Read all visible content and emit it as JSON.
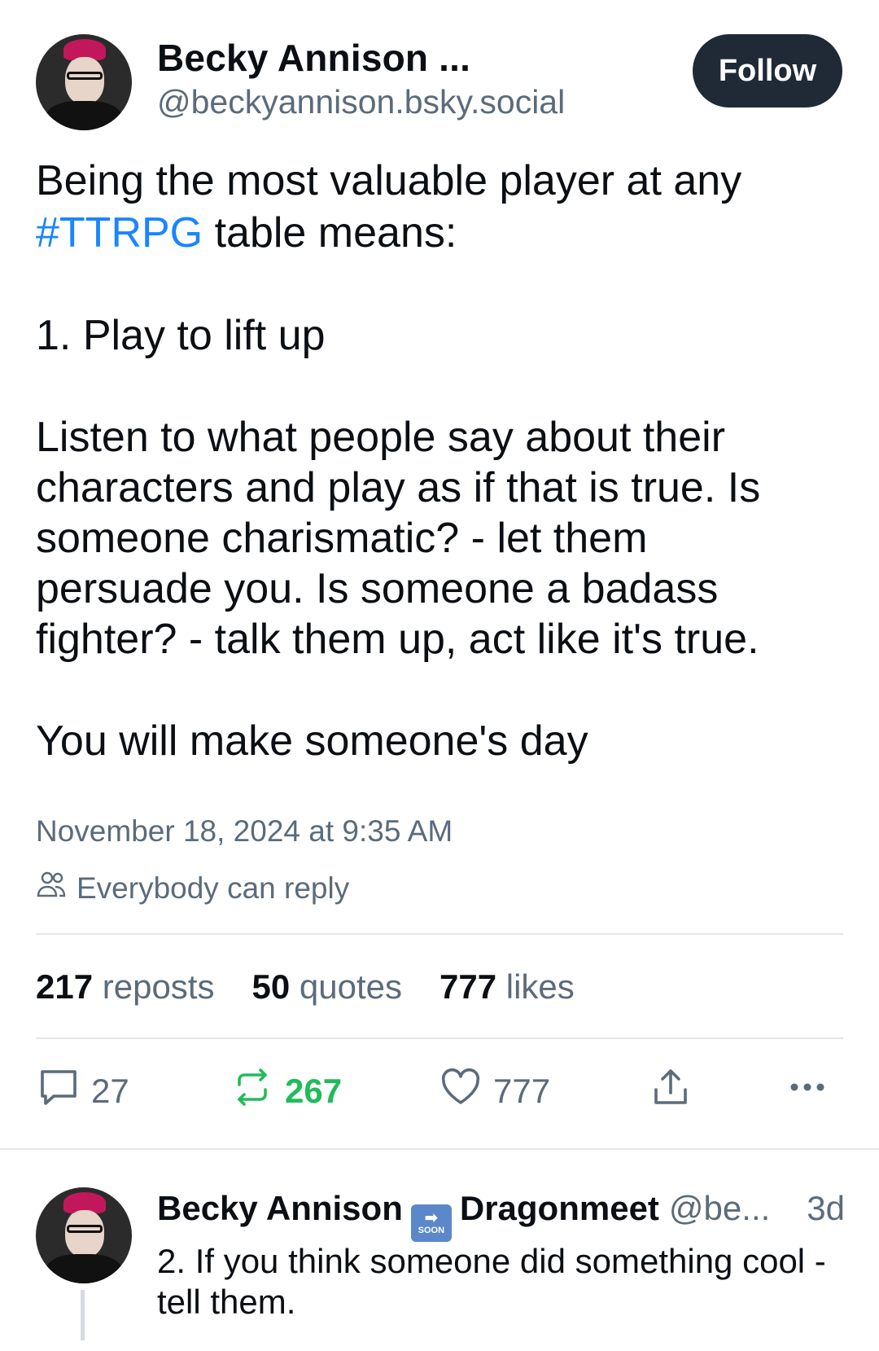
{
  "post": {
    "author_name": "Becky Annison ...",
    "author_handle": "@beckyannison.bsky.social",
    "follow_label": "Follow",
    "text_before_hashtag": "Being the most valuable player at any",
    "hashtag": "#TTRPG",
    "text_after_hashtag": " table means:",
    "point_1": "1. Play to lift up",
    "paragraph": "Listen to what people say about their characters and play as if that is true. Is someone charismatic? - let them persuade you. Is someone a badass fighter? - talk them up, act like it's true.",
    "closing": "You will make someone's day",
    "timestamp": "November 18, 2024 at 9:35 AM",
    "reply_setting": "Everybody can reply",
    "stats": {
      "reposts_count": "217",
      "reposts_label": "reposts",
      "quotes_count": "50",
      "quotes_label": "quotes",
      "likes_count": "777",
      "likes_label": "likes"
    },
    "actions": {
      "replies": "27",
      "reposts": "267",
      "likes": "777"
    },
    "colors": {
      "hashtag": "#1a85ff",
      "repost_active": "#20bc5a",
      "follow_bg": "#1f2a36"
    }
  },
  "reply": {
    "author_name": "Becky Annison",
    "soon_emoji_label": "SOON",
    "author_name_suffix": "Dragonmeet",
    "author_handle": "@be...",
    "time": "3d",
    "text": "2. If you think someone did something cool - tell them."
  },
  "icons": [
    "people-icon",
    "comment-icon",
    "repost-icon",
    "heart-icon",
    "share-icon",
    "more-icon"
  ]
}
